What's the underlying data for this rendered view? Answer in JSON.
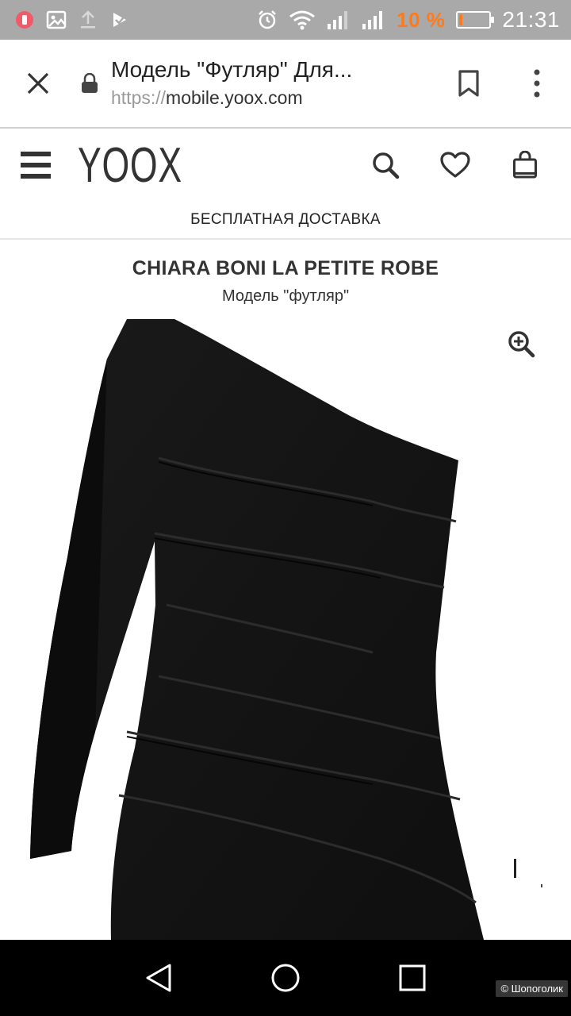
{
  "status_bar": {
    "battery_percent": "10 %",
    "battery_level": 0.1,
    "time": "21:31",
    "colors": {
      "background": "#a9a9a9",
      "battery_accent": "#ff7a1a"
    },
    "left_icons": [
      "notification-icon",
      "image-icon",
      "upload-icon",
      "checkmark-icon"
    ],
    "right_icons": [
      "alarm-icon",
      "wifi-icon",
      "signal-icon",
      "signal-icon"
    ]
  },
  "browser_bar": {
    "page_title": "Модель \"Футляр\" Для...",
    "url_scheme": "https://",
    "url_host": "mobile.yoox.com"
  },
  "site_header": {
    "logo": "YOOX",
    "shipping_text": "БЕСПЛАТНАЯ ДОСТАВКА"
  },
  "product": {
    "brand": "CHIARA BONI LA PETITE ROBE",
    "model": "Модель \"футляр\"",
    "image_description_icon": "dress-photo"
  },
  "watermark": "© Шопоголик"
}
